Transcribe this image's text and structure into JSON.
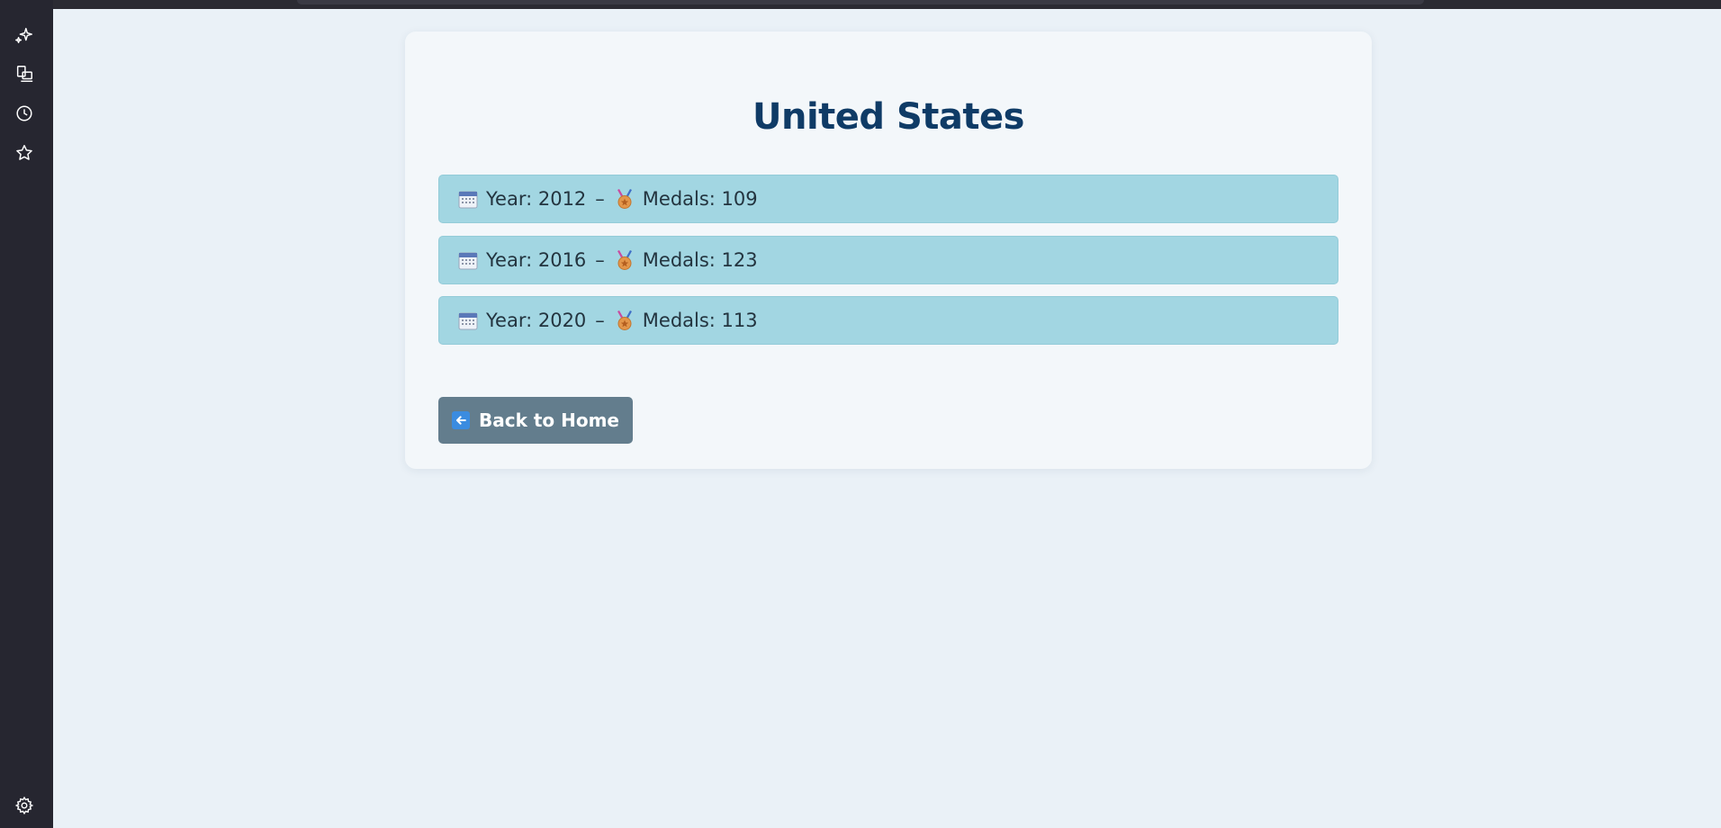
{
  "page": {
    "title": "United States"
  },
  "records": [
    {
      "year_label": "Year: 2012",
      "separator": "–",
      "medals_label": "Medals: 109"
    },
    {
      "year_label": "Year: 2016",
      "separator": "–",
      "medals_label": "Medals: 123"
    },
    {
      "year_label": "Year: 2020",
      "separator": "–",
      "medals_label": "Medals: 113"
    }
  ],
  "actions": {
    "back_label": "Back to Home"
  },
  "sidebar": {
    "icons": [
      "sparkle-icon",
      "devices-icon",
      "history-icon",
      "star-icon",
      "settings-icon"
    ]
  },
  "colors": {
    "title": "#0f3b66",
    "entry_bg": "#a2d6e2",
    "button_bg": "#637d8d",
    "page_bg": "#eaf1f7",
    "card_bg": "#f3f7fa",
    "rail_bg": "#262630"
  }
}
